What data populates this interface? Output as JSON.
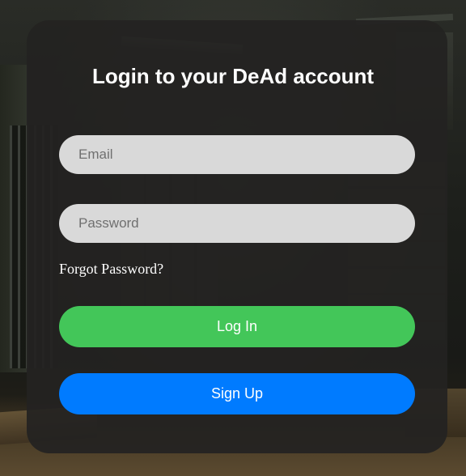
{
  "login": {
    "title": "Login to your DeAd account",
    "email_placeholder": "Email",
    "password_placeholder": "Password",
    "forgot_password_label": "Forgot Password?",
    "login_button_label": "Log In",
    "signup_button_label": "Sign Up"
  },
  "colors": {
    "login_button": "#43c659",
    "signup_button": "#007bff",
    "input_background": "#d9d9d9",
    "card_background": "#242221"
  }
}
